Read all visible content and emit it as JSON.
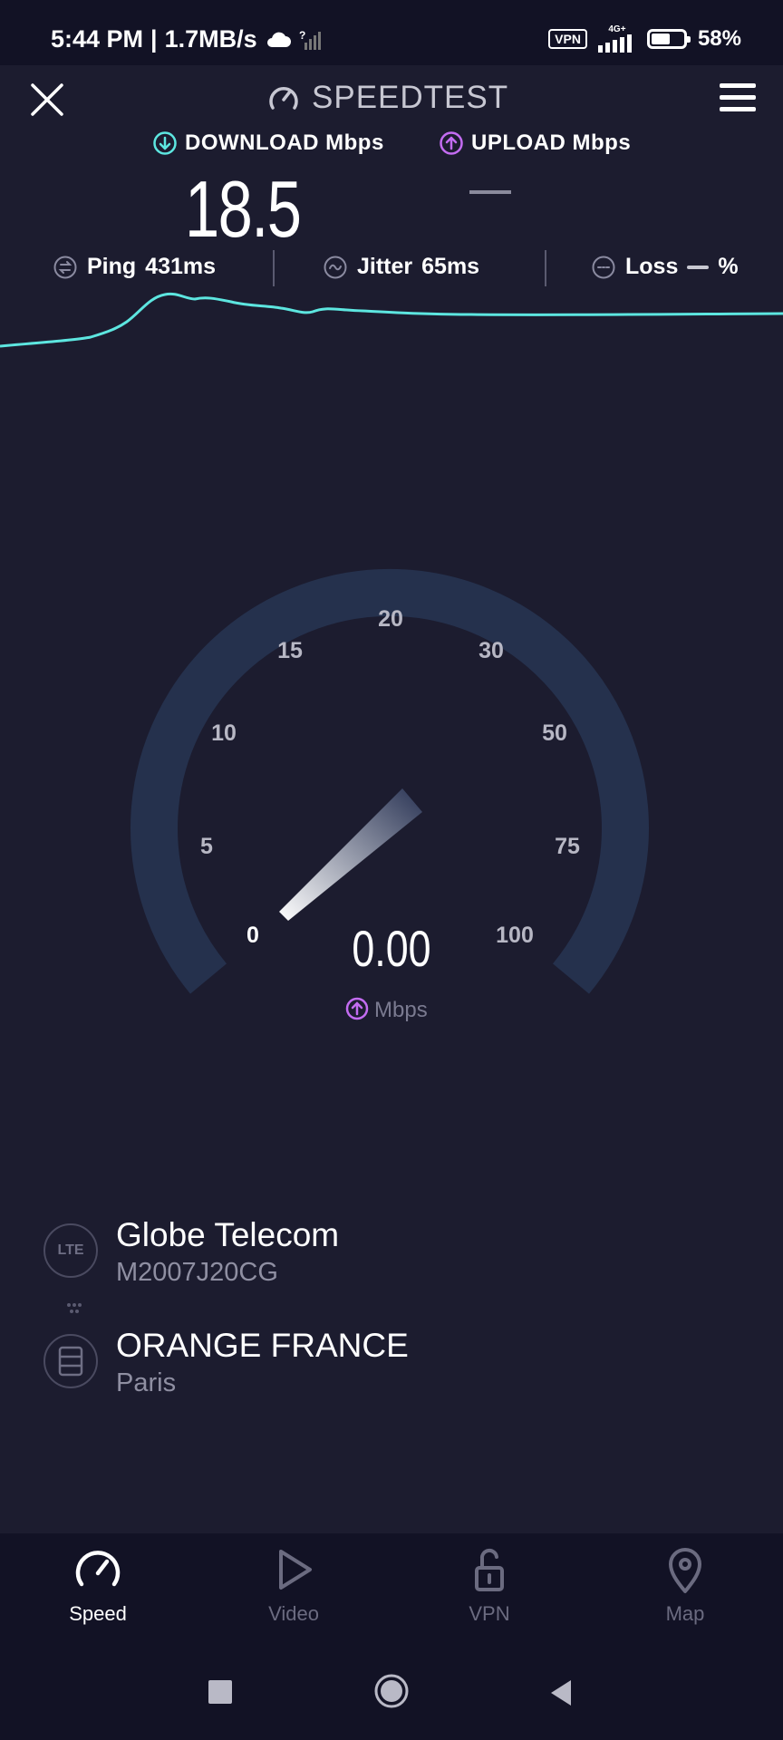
{
  "status_bar": {
    "time": "5:44 PM",
    "speed": "1.7MB/s",
    "vpn": "VPN",
    "network": "4G+",
    "battery_percent": "58%",
    "battery_level": 0.58
  },
  "header": {
    "title": "SPEEDTEST"
  },
  "metrics": {
    "download_label": "DOWNLOAD Mbps",
    "download_value": "18.5",
    "upload_label": "UPLOAD Mbps"
  },
  "stats": {
    "ping_label": "Ping",
    "ping_value": "431ms",
    "jitter_label": "Jitter",
    "jitter_value": "65ms",
    "loss_label": "Loss",
    "loss_unit": "%"
  },
  "gauge": {
    "ticks": [
      "0",
      "5",
      "10",
      "15",
      "20",
      "30",
      "50",
      "75",
      "100"
    ],
    "value": "0.00",
    "unit": "Mbps"
  },
  "connection": {
    "isp_icon": "LTE",
    "isp_name": "Globe Telecom",
    "device": "M2007J20CG",
    "server_name": "ORANGE FRANCE",
    "server_city": "Paris"
  },
  "nav": {
    "items": [
      {
        "label": "Speed",
        "icon": "speed-icon"
      },
      {
        "label": "Video",
        "icon": "play-icon"
      },
      {
        "label": "VPN",
        "icon": "lock-icon"
      },
      {
        "label": "Map",
        "icon": "map-pin-icon"
      }
    ]
  },
  "colors": {
    "background": "#1c1c2f",
    "download_accent": "#5de6e0",
    "upload_accent": "#c36cf1",
    "gauge_track": "#25314d"
  }
}
